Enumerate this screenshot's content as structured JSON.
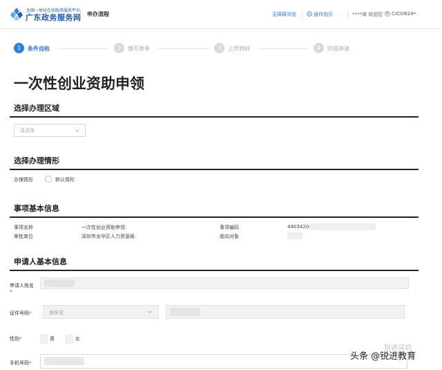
{
  "header": {
    "platform_sub": "全国一体化在线政务服务平台",
    "platform_name": "广东政务服务网",
    "page_name": "申办流程",
    "accessibility": "无障碍浏览",
    "guide": "操作指引",
    "welcome": "****琦 欢迎您",
    "user": "CICI0624"
  },
  "steps": [
    {
      "num": "1",
      "label": "条件自检"
    },
    {
      "num": "2",
      "label": "填写表单"
    },
    {
      "num": "3",
      "label": "上传材料"
    },
    {
      "num": "4",
      "label": "完成申请"
    }
  ],
  "page_title": "一次性创业资助申领",
  "region": {
    "title": "选择办理区域",
    "placeholder": "请选择"
  },
  "scenario": {
    "title": "选择办理情形",
    "label": "办理情形",
    "option": "默认情形"
  },
  "item_info": {
    "title": "事项基本信息",
    "name_label": "事项名称",
    "name_value": "一次性创业资助申领",
    "code_label": "事项编码",
    "code_value": "440342000",
    "dept_label": "审批单位",
    "dept_value": "深圳市龙华区人力资源局",
    "target_label": "面向对象"
  },
  "applicant": {
    "title": "申请人基本信息",
    "name_label": "申请人姓名",
    "required_mark": "*",
    "id_label": "证件号码",
    "id_type": "身份证",
    "gender_label": "性别",
    "male": "男",
    "female": "女",
    "phone_label": "手机号码"
  },
  "watermark": {
    "main": "头条 @锐进教育",
    "sub": "锐进深圳"
  }
}
